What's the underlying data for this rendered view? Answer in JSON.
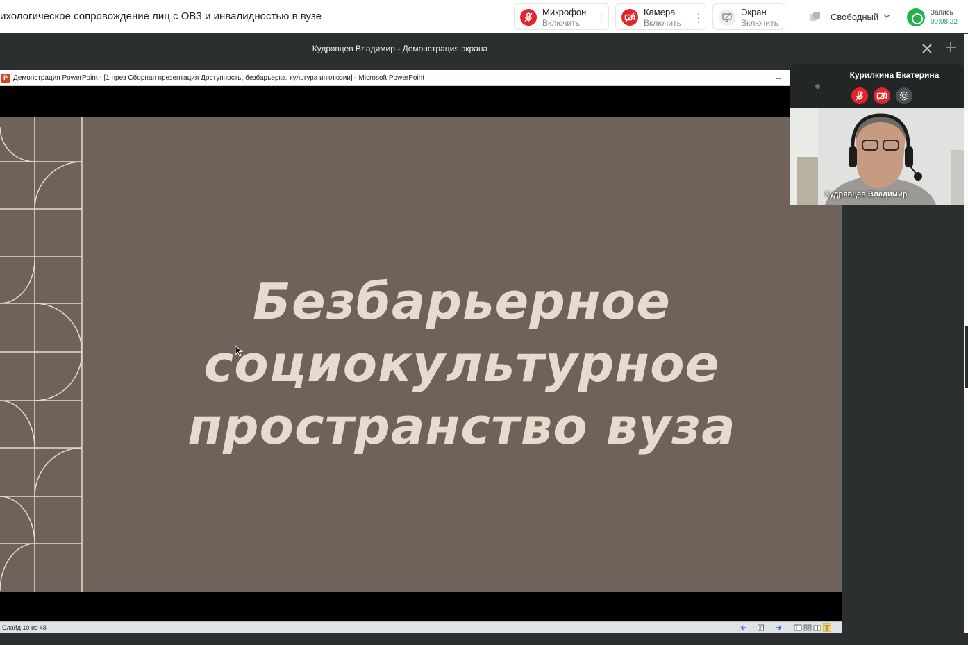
{
  "meeting": {
    "title": "ихологическое сопровождение лиц с ОВЗ и инвалидностью в вузе"
  },
  "controls": {
    "microphone": {
      "label": "Микрофон",
      "action": "Включить"
    },
    "camera": {
      "label": "Камера",
      "action": "Включить"
    },
    "screen": {
      "label": "Экран",
      "action": "Включить"
    },
    "status": {
      "value": "Свободный"
    },
    "recording": {
      "label": "Запись",
      "time": "00:08:22"
    }
  },
  "share": {
    "title": "Кудрявцев Владимир - Демонстрация экрана"
  },
  "powerpoint": {
    "window_title": "Демонстрация PowerPoint - [1 през Сборная презентация Доступность, безбарьерка, культура инклюзии] - Microsoft PowerPoint",
    "logo_letter": "P",
    "slide_count": "Слайд 10 из 48",
    "slide": {
      "title_lines": [
        "Безбарьерное",
        "социокультурное",
        "пространство вуза"
      ],
      "background_color": "#6e625a",
      "text_color": "#e6dccd"
    }
  },
  "participant": {
    "name": "Курилкина Екатерина"
  },
  "video": {
    "speaker_name": "Кудрявцев Владимир"
  },
  "colors": {
    "accent_red": "#e3242b",
    "accent_green": "#21b24c",
    "dark_bg": "#2c2f30"
  }
}
